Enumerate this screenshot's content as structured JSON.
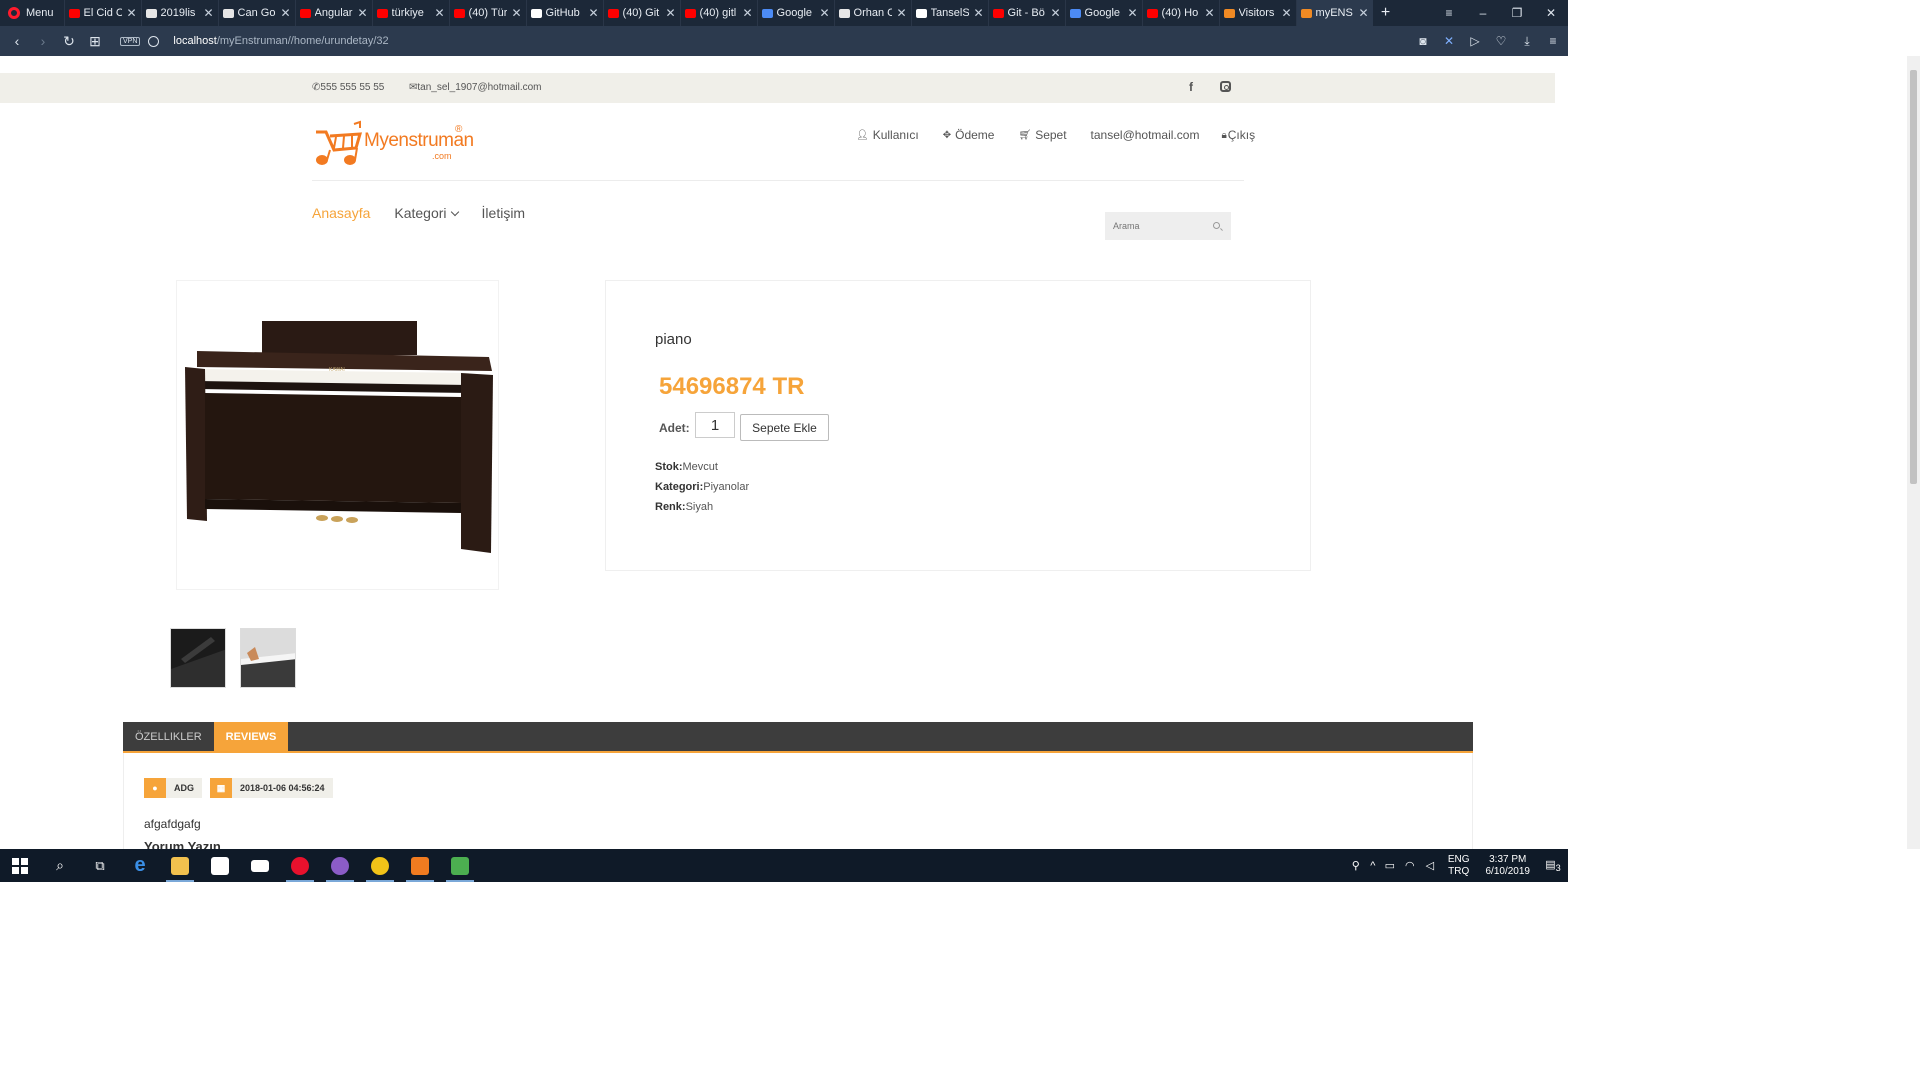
{
  "browser": {
    "menu_label": "Menu",
    "tabs": [
      {
        "title": "El Cid C",
        "color": "#ff0000"
      },
      {
        "title": "2019lis",
        "color": "#e6e6e6"
      },
      {
        "title": "Can Go",
        "color": "#e6e6e6"
      },
      {
        "title": "Angular",
        "color": "#ff0000"
      },
      {
        "title": "türkiye",
        "color": "#ff0000"
      },
      {
        "title": "(40) Tür",
        "color": "#ff0000"
      },
      {
        "title": "GitHub",
        "color": "#ffffff"
      },
      {
        "title": "(40) Git",
        "color": "#ff0000"
      },
      {
        "title": "(40) gitl",
        "color": "#ff0000"
      },
      {
        "title": "Google",
        "color": "#4c8bf5"
      },
      {
        "title": "Orhan C",
        "color": "#e6e6e6"
      },
      {
        "title": "TanselS",
        "color": "#ffffff"
      },
      {
        "title": "Git - Bö",
        "color": "#ff0000"
      },
      {
        "title": "Google",
        "color": "#4c8bf5"
      },
      {
        "title": "(40) Ho",
        "color": "#ff0000"
      },
      {
        "title": "Visitors",
        "color": "#f08a24"
      },
      {
        "title": "myENS",
        "color": "#f08a24"
      }
    ],
    "url_host": "localhost",
    "url_path": "/myEnstruman//home/urundetay/32",
    "vpn_label": "VPN"
  },
  "site": {
    "phone": "555 555 55 55",
    "email": "tan_sel_1907@hotmail.com",
    "logo_text": "Myenstruman",
    "logo_suffix": ".com",
    "logo_mark": "®",
    "user_menu": {
      "user": "Kullanıcı",
      "payment": "Ödeme",
      "cart": "Sepet",
      "account": "tansel@hotmail.com",
      "logout": "Çıkış"
    },
    "nav": {
      "home": "Anasayfa",
      "category": "Kategori",
      "contact": "İletişim"
    },
    "search_placeholder": "Arama"
  },
  "product": {
    "name": "piano",
    "price": "54696874 TR",
    "qty_label": "Adet:",
    "qty_value": "1",
    "add_to_cart": "Sepete Ekle",
    "stock_label": "Stok:",
    "stock_value": "Mevcut",
    "category_label": "Kategori:",
    "category_value": "Piyanolar",
    "color_label": "Renk:",
    "color_value": "Siyah",
    "brand_on_piano": "KAWAI"
  },
  "tabs": {
    "features": "ÖZELLIKLER",
    "reviews": "REVIEWS"
  },
  "review": {
    "author": "ADG",
    "date": "2018-01-06 04:56:24",
    "text": "afgafdgafg",
    "write_heading": "Yorum Yazın"
  },
  "taskbar": {
    "lang_top": "ENG",
    "lang_bottom": "TRQ",
    "time": "3:37 PM",
    "date": "6/10/2019",
    "notif_count": "3"
  },
  "colors": {
    "accent": "#f6a43a",
    "brand": "#f27a21",
    "chrome_dark": "#1c2838",
    "tab_dark": "#3d3d3d"
  }
}
